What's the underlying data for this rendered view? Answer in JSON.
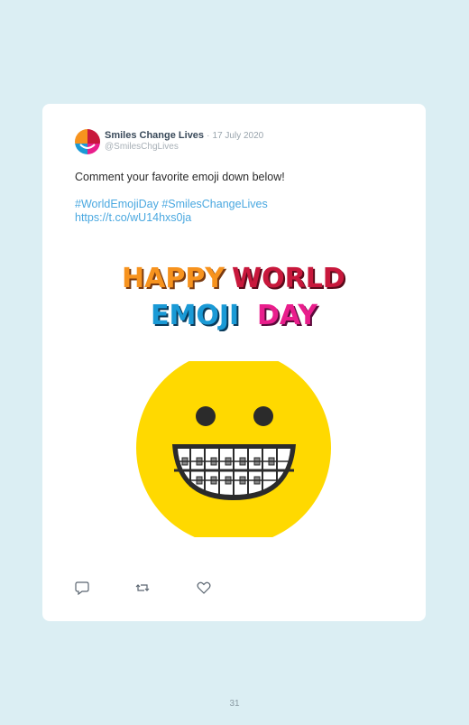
{
  "tweet": {
    "author": "Smiles Change Lives",
    "separator": "·",
    "date": "17 July 2020",
    "handle": "@SmilesChgLives",
    "text": "Comment your favorite emoji down below!",
    "hashtags": "#WorldEmojiDay #SmilesChangeLives",
    "link": "https://t.co/wU14hxs0ja"
  },
  "graphic": {
    "word_happy": "HAPPY",
    "word_world": "WORLD",
    "word_emoji": "EMOJI",
    "word_day": "DAY",
    "colors": {
      "happy": "#f7931e",
      "world": "#c8183c",
      "emoji": "#1a9ad6",
      "day": "#e91e8c",
      "face": "#ffd900",
      "eyes": "#2b2b2b"
    }
  },
  "actions": {
    "icons": [
      "reply-icon",
      "retweet-icon",
      "like-icon"
    ]
  },
  "page": {
    "number": "31"
  }
}
